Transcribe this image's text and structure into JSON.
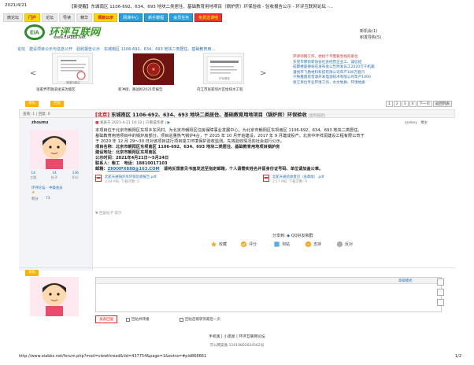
{
  "header": {
    "date": "2021/4/21",
    "title": "【新提醒】东城南区 1106-692、634、693 地块二类居住、基础教育用地项目（锅炉房）环保验收 - 验收报告公示 - 环评互联网论坛 -..."
  },
  "nav": {
    "items": [
      "微论坛",
      "门户",
      "论坛",
      "导读",
      "精华",
      "项目公示",
      "网课中心",
      "新手教程",
      "会员任务",
      "免费送课啦"
    ]
  },
  "login_menu": {
    "items": [
      "新机会(1)",
      "积发导购(5)"
    ]
  },
  "site": {
    "name": "环评互联网",
    "url": "www.EIAbbs.Net",
    "logo_text": "EIA"
  },
  "breadcrumb": "论坛　建设项目公示与信息公开　验收报告公示　东城南区 1106-692、634、693 地块二类居住、基础教育用...",
  "slider": {
    "captions": [
      "张家界市隧道坐溪功能区",
      "新冲街、路战岭2021年报告",
      "内江市张家坝片区给排水工程"
    ],
    "thumb_text": [
      "隧道功能区",
      "",
      "环评报告"
    ]
  },
  "news": {
    "items": [
      "环评师网工作，想找个不需要急找的单位",
      "东莞市厚街新协会社会经营企业工、诚信招",
      "成都楼座德祝在发布会公告附发员工2020万千机箱",
      "潼悦市飞盾材料科技有限公司年产100万套汽",
      "宁陕鑫雷宾普源开发电源技术有限公司年产1000",
      "浙江单位专业环境工作，水文地质、环境地质"
    ]
  },
  "thread": {
    "reply_button": "发帖",
    "reply_button2": "回复",
    "view_label": "查看: 1 | 回复: 0",
    "tag": "[北京]",
    "title": "东城南区 1106-692、634、693 地块二类居住、基础教育用地项目（锅炉房）环保验收",
    "title_suffix": "[复制链接]",
    "author": "zhoumu",
    "meta_prefix": "发表于 2021-4-21 10:32 | 只看该作者 |",
    "meta_filter": "▶",
    "post_by": "onekey　楼主",
    "pager": [
      "1",
      "2",
      "3",
      "4",
      "下一页",
      "返回列表"
    ]
  },
  "user": {
    "stats": [
      {
        "value": "14",
        "label": "主题"
      },
      {
        "value": "14",
        "label": "帖子"
      },
      {
        "value": "136",
        "label": "积分"
      }
    ],
    "rank": "环评论坛 - 中级会员",
    "score_label": "积分",
    "score_value": "73"
  },
  "post": {
    "lines": [
      "本项目位于北京市朝阳区东坝乡东风村。为北京市朝阳区住房保障事业发展中心。为北京市朝阳区东坝南区 1106-692、634、693 地块二类居住、",
      "基础教育用地项目中的锅炉房部分。项目总量热气锅炉4台，于 2015 年 10 月开始建设，2017 年 9 月建成投产。北京中环祥润建设工程有限公司于",
      "于 2020 年 12 月 29～30 日对该项目进行项目竣工环境保护验收监测。先将验收情况向社会进行公示。"
    ],
    "fields": [
      "项目名称：北京市朝阳区东坝南区 1106-692、634、693 地块二类居住、基础教育用地项目锅炉房",
      "建设地址：北京市朝阳区东坝南区",
      "公示时间：2021年4月21日～5月24日",
      "联系人：柴工　电话：18810017103"
    ],
    "mail_prefix": "邮箱：",
    "mail_value": "ZHXXPX888@163.COM",
    "mail_suffix": "　请将反馈意见书面发送至指定邮箱，个人请需实姓名并留身份证号码、单位请加盖公章。",
    "attachments": [
      {
        "name": "北航天通锅炉房环保验收报告.pdf",
        "size": "3.04 MB, 下载次数: 0"
      },
      {
        "name": "北航天通验收意见（盖章版）.pdf",
        "size": "2.17 MB, 下载次数: 0"
      }
    ],
    "edit_note": "▼ 回复帖子 提示"
  },
  "share": {
    "label": "分享到:",
    "targets": "QQ好友和群"
  },
  "actions": [
    "收藏",
    "评分",
    "淘帖",
    "支持",
    "反对"
  ],
  "reply": {
    "advanced": "高级模式",
    "submit": "发表回复",
    "check1": "回帖并转播",
    "check2": "回帖后跳转到最后一页"
  },
  "footer": {
    "links": "手机版 | 小黑屋 | 环评互联网论坛",
    "icp": "京公网安备 11010802024562号",
    "url": "http://www.eiabbs.net/forum.php?mod=viewthread&tid=437754&page=1&extra=#pid868661",
    "page": "1/2"
  }
}
